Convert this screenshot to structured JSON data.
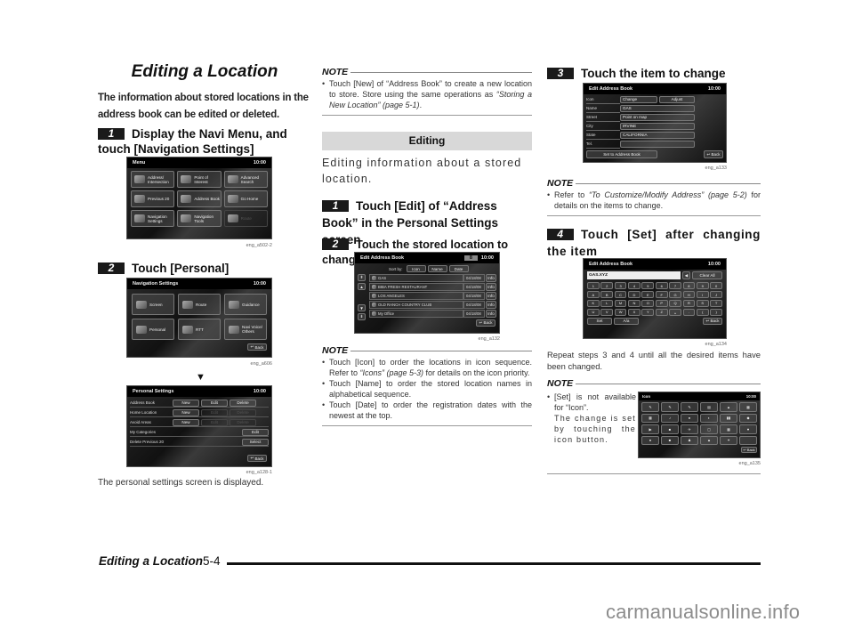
{
  "page": {
    "title": "Editing a Location",
    "intro": "The information about stored locations in the address book can be edited or deleted."
  },
  "left": {
    "step1": {
      "num": "1",
      "text": "Display the Navi Menu, and touch [Navigation Settings]"
    },
    "step2": {
      "num": "2",
      "text": "Touch [Personal]"
    },
    "menu_screen": {
      "title": "Menu",
      "time": "10:00",
      "items": [
        "Address/ Intersection",
        "Point of Interest",
        "Advanced Search",
        "Previous 20",
        "Address Book",
        "Go Home",
        "Navigation Settings",
        "Navigation Tools",
        "Route"
      ],
      "caption": "eng_a502-2"
    },
    "nav_settings_screen": {
      "title": "Navigation Settings",
      "time": "10:00",
      "items": [
        "Screen",
        "Route",
        "Guidance",
        "Personal",
        "RTT",
        "Navi Voice/ Others"
      ],
      "back": "Back",
      "caption": "eng_a606"
    },
    "arrow": "▼",
    "personal_screen": {
      "title": "Personal Settings",
      "time": "10:00",
      "rows": [
        {
          "label": "Address Book",
          "buttons": [
            "New",
            "Edit",
            "Delete"
          ]
        },
        {
          "label": "Home Location",
          "buttons": [
            "New",
            "Edit",
            "Delete"
          ]
        },
        {
          "label": "Avoid Areas",
          "buttons": [
            "New",
            "Edit",
            "Delete"
          ]
        },
        {
          "label": "My Categories",
          "buttons": [
            "Edit"
          ]
        },
        {
          "label": "Delete Previous 20",
          "buttons": [
            "Select"
          ]
        }
      ],
      "back": "Back",
      "caption": "eng_a128-1"
    },
    "result": "The personal settings screen is displayed."
  },
  "middle": {
    "note1": {
      "label": "NOTE",
      "text_a": "Touch [New] of “Address Book” to create a new location to store. Store using the same operations as ",
      "text_ref": "“Storing a New Location” (page 5-1)",
      "text_b": "."
    },
    "section": "Editing",
    "lead": "Editing information about a stored location.",
    "step1": {
      "num": "1",
      "text": "Touch [Edit] of “Address Book” in the Personal Settings screen"
    },
    "step2": {
      "num": "2",
      "text": "Touch the stored location to change"
    },
    "list_screen": {
      "title": "Edit Address Book",
      "count": "8",
      "time": "10:00",
      "sort_label": "Sort by:",
      "sort_buttons": [
        "Icon",
        "Name",
        "Date"
      ],
      "rows": [
        {
          "name": "GAS",
          "date": "04/18/08",
          "info": "Info"
        },
        {
          "name": "BIBA FRESH RESTAURANT",
          "date": "04/18/08",
          "info": "Info"
        },
        {
          "name": "LOS ANGELES",
          "date": "04/18/08",
          "info": "Info"
        },
        {
          "name": "OLD RANCH COUNTRY CLUB",
          "date": "04/18/08",
          "info": "Info"
        },
        {
          "name": "My Office",
          "date": "04/18/08",
          "info": "Info"
        }
      ],
      "back": "Back",
      "caption": "eng_a132"
    },
    "note2": {
      "label": "NOTE",
      "items": [
        {
          "a": "Touch [Icon] to order the locations in icon sequence. Refer to ",
          "ref": "“Icons” (page 5-3)",
          "b": " for details on the icon priority."
        },
        {
          "a": "Touch [Name] to order the stored location names in alphabetical sequence.",
          "ref": "",
          "b": ""
        },
        {
          "a": "Touch [Date] to order the registration dates with the newest at the top.",
          "ref": "",
          "b": ""
        }
      ]
    }
  },
  "right": {
    "step3": {
      "num": "3",
      "text": "Touch the item to change"
    },
    "edit_screen": {
      "title": "Edit Address Book",
      "time": "10:00",
      "rows": [
        {
          "label": "Icon",
          "value": "Change",
          "extra": "Adjust"
        },
        {
          "label": "Name",
          "value": "GAS"
        },
        {
          "label": "Street",
          "value": "Point on map"
        },
        {
          "label": "City",
          "value": "IRVINE"
        },
        {
          "label": "State",
          "value": "CALIFORNIA"
        },
        {
          "label": "Tel.",
          "value": ""
        }
      ],
      "set_button": "Set to Address Book",
      "back": "Back",
      "caption": "eng_a133"
    },
    "note1": {
      "label": "NOTE",
      "a": "Refer to ",
      "ref": "“To Customize/Modify Address” (page 5-2)",
      "b": " for details on the items to change."
    },
    "step4": {
      "num": "4",
      "text": "Touch [Set] after changing the item"
    },
    "keyboard_screen": {
      "title": "Edit Address Book",
      "time": "10:00",
      "input_value": "GAS.XYZ",
      "clear_all": "Clear All",
      "keys": [
        "1",
        "2",
        "3",
        "4",
        "5",
        "6",
        "7",
        "8",
        "9",
        "0",
        "A",
        "B",
        "C",
        "D",
        "E",
        "F",
        "G",
        "H",
        "I",
        "J",
        "K",
        "L",
        "M",
        "N",
        "O",
        "P",
        "Q",
        "R",
        "S",
        "T",
        "U",
        "V",
        "W",
        "X",
        "Y",
        "Z",
        "␣",
        ".",
        "(",
        ")"
      ],
      "more": "More",
      "set": "Set",
      "case": "A/a",
      "back": "Back",
      "caption": "eng_a134"
    },
    "repeat": "Repeat steps 3 and 4 until all the desired items have been changed.",
    "note2": {
      "label": "NOTE",
      "line1": "[Set] is not available for “Icon”.",
      "line2": "The change is set by touching the icon button."
    },
    "icon_screen": {
      "title": "Icon",
      "time": "10:00",
      "icons": [
        "✎",
        "✎",
        "✎",
        "▤",
        "▲",
        "▦",
        "▦",
        "♪",
        "●",
        "◐",
        "▮▮",
        "◆",
        "▶",
        "■",
        "✈",
        "▢",
        "▦",
        "♥",
        "●",
        "■",
        "♟",
        "▲",
        "✦",
        ""
      ],
      "back": "Back",
      "caption": "eng_a135"
    }
  },
  "footer": {
    "title": "Editing a Location",
    "page": "5-4"
  },
  "watermark": "carmanualsonline.info"
}
